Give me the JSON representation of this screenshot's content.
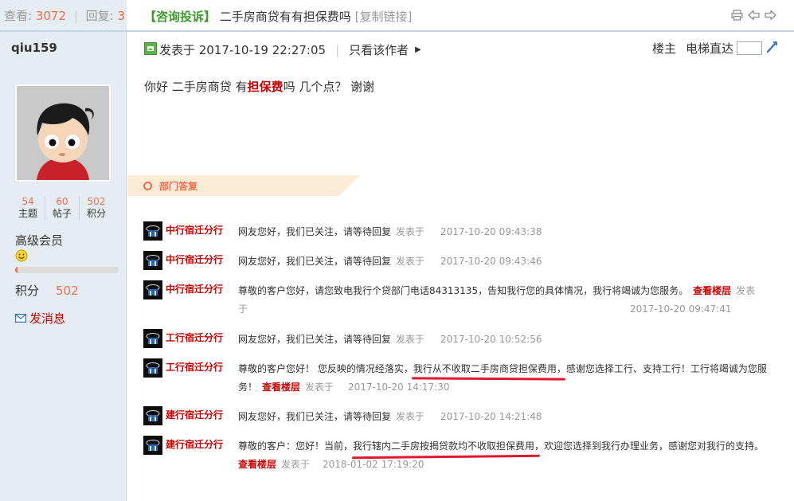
{
  "topbar": {
    "views_label": "查看:",
    "views": "3072",
    "sep": "|",
    "replies_label": "回复:",
    "replies": "3",
    "type_tag": "【咨询投诉】",
    "subject": "二手房商贷有有担保费吗",
    "copy_link": "[复制链接]"
  },
  "author": {
    "name": "qiu159",
    "stats": [
      {
        "num": "54",
        "label": "主题"
      },
      {
        "num": "60",
        "label": "帖子"
      },
      {
        "num": "502",
        "label": "积分"
      }
    ],
    "rank": "高级会员",
    "level_progress": 0.02,
    "points_label": "积分",
    "points": "502",
    "send_message": "发消息"
  },
  "post": {
    "posted_at": "发表于 2017-10-19 22:27:05",
    "sep": "|",
    "only_author": "只看该作者",
    "floor_label": "楼主",
    "elevator_label": "电梯直达",
    "content_before": "你好 二手房商贷 有",
    "content_highlight": "担保费",
    "content_after": "吗 几个点？ 谢谢"
  },
  "dept_reply": {
    "title": "部门答复"
  },
  "replies": [
    {
      "bank": "中行宿迁分行",
      "text": "网友您好，我们已关注，请等待回复",
      "link": "",
      "said": "发表于",
      "time": "2017-10-20 09:43:38"
    },
    {
      "bank": "中行宿迁分行",
      "text": "网友您好，我们已关注，请等待回复",
      "link": "",
      "said": "发表于",
      "time": "2017-10-20 09:43:46"
    },
    {
      "bank": "中行宿迁分行",
      "text": "尊敬的客户您好，请您致电我行个贷部门电话84313135，告知我行您的具体情况，我行将竭诚为您服务。",
      "link": "查看楼层",
      "said": "发表于",
      "time": "2017-10-20 09:47:41"
    },
    {
      "bank": "工行宿迁分行",
      "text": "网友您好，我们已关注，请等待回复",
      "link": "",
      "said": "发表于",
      "time": "2017-10-20 10:52:56"
    },
    {
      "bank": "工行宿迁分行",
      "text": "尊敬的客户您好！ 您反映的情况经落实，我行从不收取二手房商贷担保费用，感谢您选择工行、支持工行！工行将竭诚为您服务！",
      "link": "查看楼层",
      "said": "发表于",
      "time": "2017-10-20 14:17:30"
    },
    {
      "bank": "建行宿迁分行",
      "text": "网友您好，我们已关注，请等待回复",
      "link": "",
      "said": "发表于",
      "time": "2017-10-20 14:21:48"
    },
    {
      "bank": "建行宿迁分行",
      "text": "尊敬的客户：您好！当前，我行辖内二手房按揭贷款均不收取担保费用，欢迎您选择到我行办理业务，感谢您对我行的支持。",
      "link": "查看楼层",
      "said": "发表于",
      "time": "2018-01-02 17:19:20"
    }
  ],
  "colors": {
    "accent_red": "#cc0000",
    "orange": "#f26c4f",
    "green_tag": "#3a9b27",
    "sidebar_bg": "#e5edf2",
    "banner_bg": "#fcecd6",
    "underline_red": "#e0172e"
  },
  "icons": [
    "print-icon",
    "prev-thread-icon",
    "next-thread-icon",
    "post-status-icon",
    "smiley-icon",
    "mail-icon",
    "jump-icon",
    "bank-avatar-icon"
  ]
}
